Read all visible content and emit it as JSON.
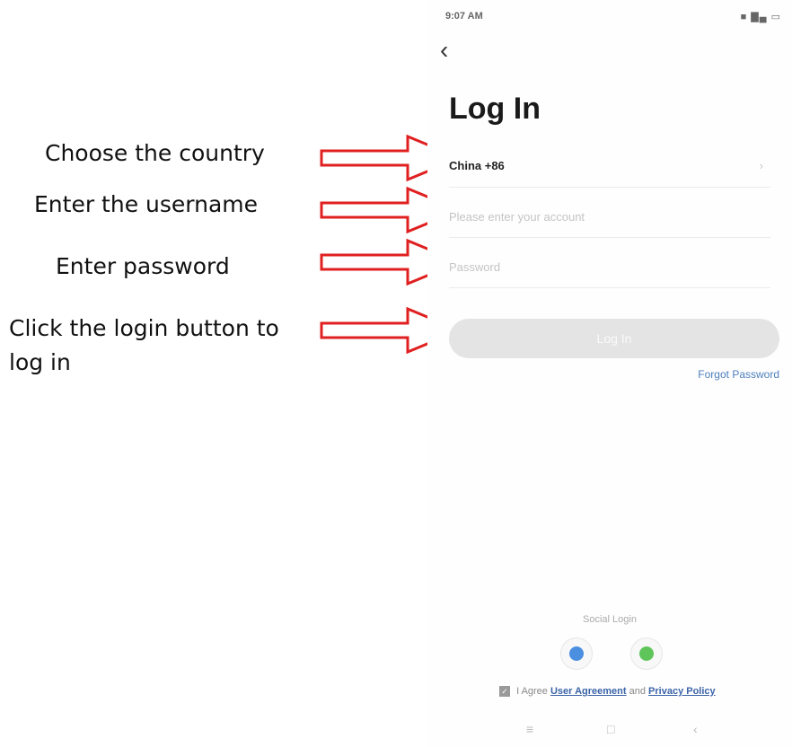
{
  "annotations": {
    "country": "Choose the country",
    "username": "Enter the username",
    "password": "Enter password",
    "login_line1": "Click the login button to",
    "login_line2": "log in",
    "arrow_color": "#e02020"
  },
  "status_bar": {
    "time": "9:07 AM",
    "icons": "■ ▇▄ ▭"
  },
  "back_icon": "chevron-left-icon",
  "login": {
    "title": "Log In",
    "country_value": "China +86",
    "account_placeholder": "Please enter your account",
    "password_placeholder": "Password",
    "login_button": "Log In",
    "forgot_password": "Forgot Password"
  },
  "social": {
    "title": "Social Login",
    "qq_icon": "qq-icon",
    "wechat_icon": "wechat-icon",
    "qq_color": "#4a8fe0",
    "wechat_color": "#5fc55a"
  },
  "agreement": {
    "prefix": "I Agree",
    "user_agreement": "User Agreement",
    "and": "and",
    "privacy_policy": "Privacy Policy"
  },
  "nav": {
    "menu": "≡",
    "home": "□",
    "back": "‹"
  }
}
